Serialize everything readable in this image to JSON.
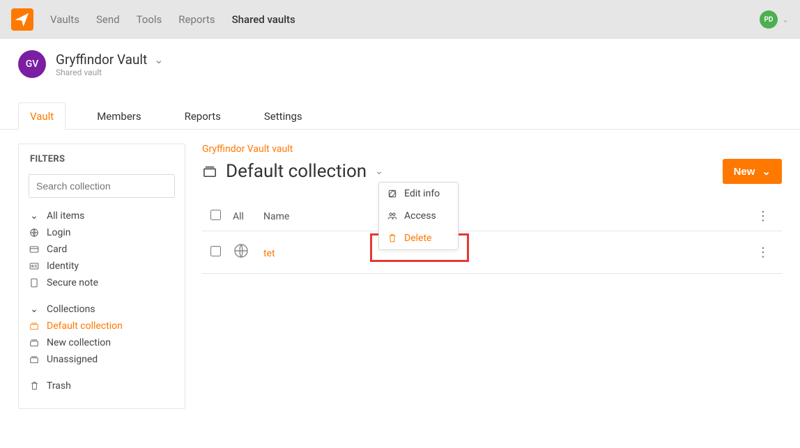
{
  "topnav": {
    "items": [
      {
        "label": "Vaults"
      },
      {
        "label": "Send"
      },
      {
        "label": "Tools"
      },
      {
        "label": "Reports"
      },
      {
        "label": "Shared vaults",
        "active": true
      }
    ]
  },
  "user": {
    "initials": "PD"
  },
  "vault": {
    "avatar": "GV",
    "name": "Gryffindor Vault",
    "subtitle": "Shared vault"
  },
  "subtabs": {
    "items": [
      {
        "label": "Vault",
        "active": true
      },
      {
        "label": "Members"
      },
      {
        "label": "Reports"
      },
      {
        "label": "Settings"
      }
    ]
  },
  "filters": {
    "title": "FILTERS",
    "search_placeholder": "Search collection",
    "groups": {
      "all_items": "All items",
      "login": "Login",
      "card": "Card",
      "identity": "Identity",
      "secure_note": "Secure note",
      "collections": "Collections",
      "default_collection": "Default collection",
      "new_collection": "New collection",
      "unassigned": "Unassigned",
      "trash": "Trash"
    }
  },
  "main": {
    "breadcrumb": "Gryffindor Vault vault",
    "collection_title": "Default collection",
    "new_label": "New"
  },
  "dropdown": {
    "edit": "Edit info",
    "access": "Access",
    "delete": "Delete"
  },
  "table": {
    "all": "All",
    "name_header": "Name",
    "rows": [
      {
        "name": "tet"
      }
    ]
  }
}
